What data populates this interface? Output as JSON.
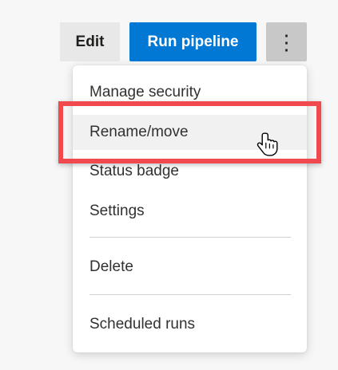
{
  "toolbar": {
    "edit_label": "Edit",
    "run_label": "Run pipeline",
    "more_glyph": "⋮"
  },
  "menu": {
    "items": [
      {
        "label": "Manage security"
      },
      {
        "label": "Rename/move"
      },
      {
        "label": "Status badge"
      },
      {
        "label": "Settings"
      },
      {
        "label": "Delete"
      },
      {
        "label": "Scheduled runs"
      }
    ],
    "hovered_item": "Rename/move"
  },
  "annotation": {
    "highlight_color": "#f04a4f"
  },
  "colors": {
    "primary": "#0078d4",
    "background": "#f7f7f7"
  },
  "icons": {
    "more": "more-vertical-icon",
    "cursor": "hand-pointer-icon"
  }
}
